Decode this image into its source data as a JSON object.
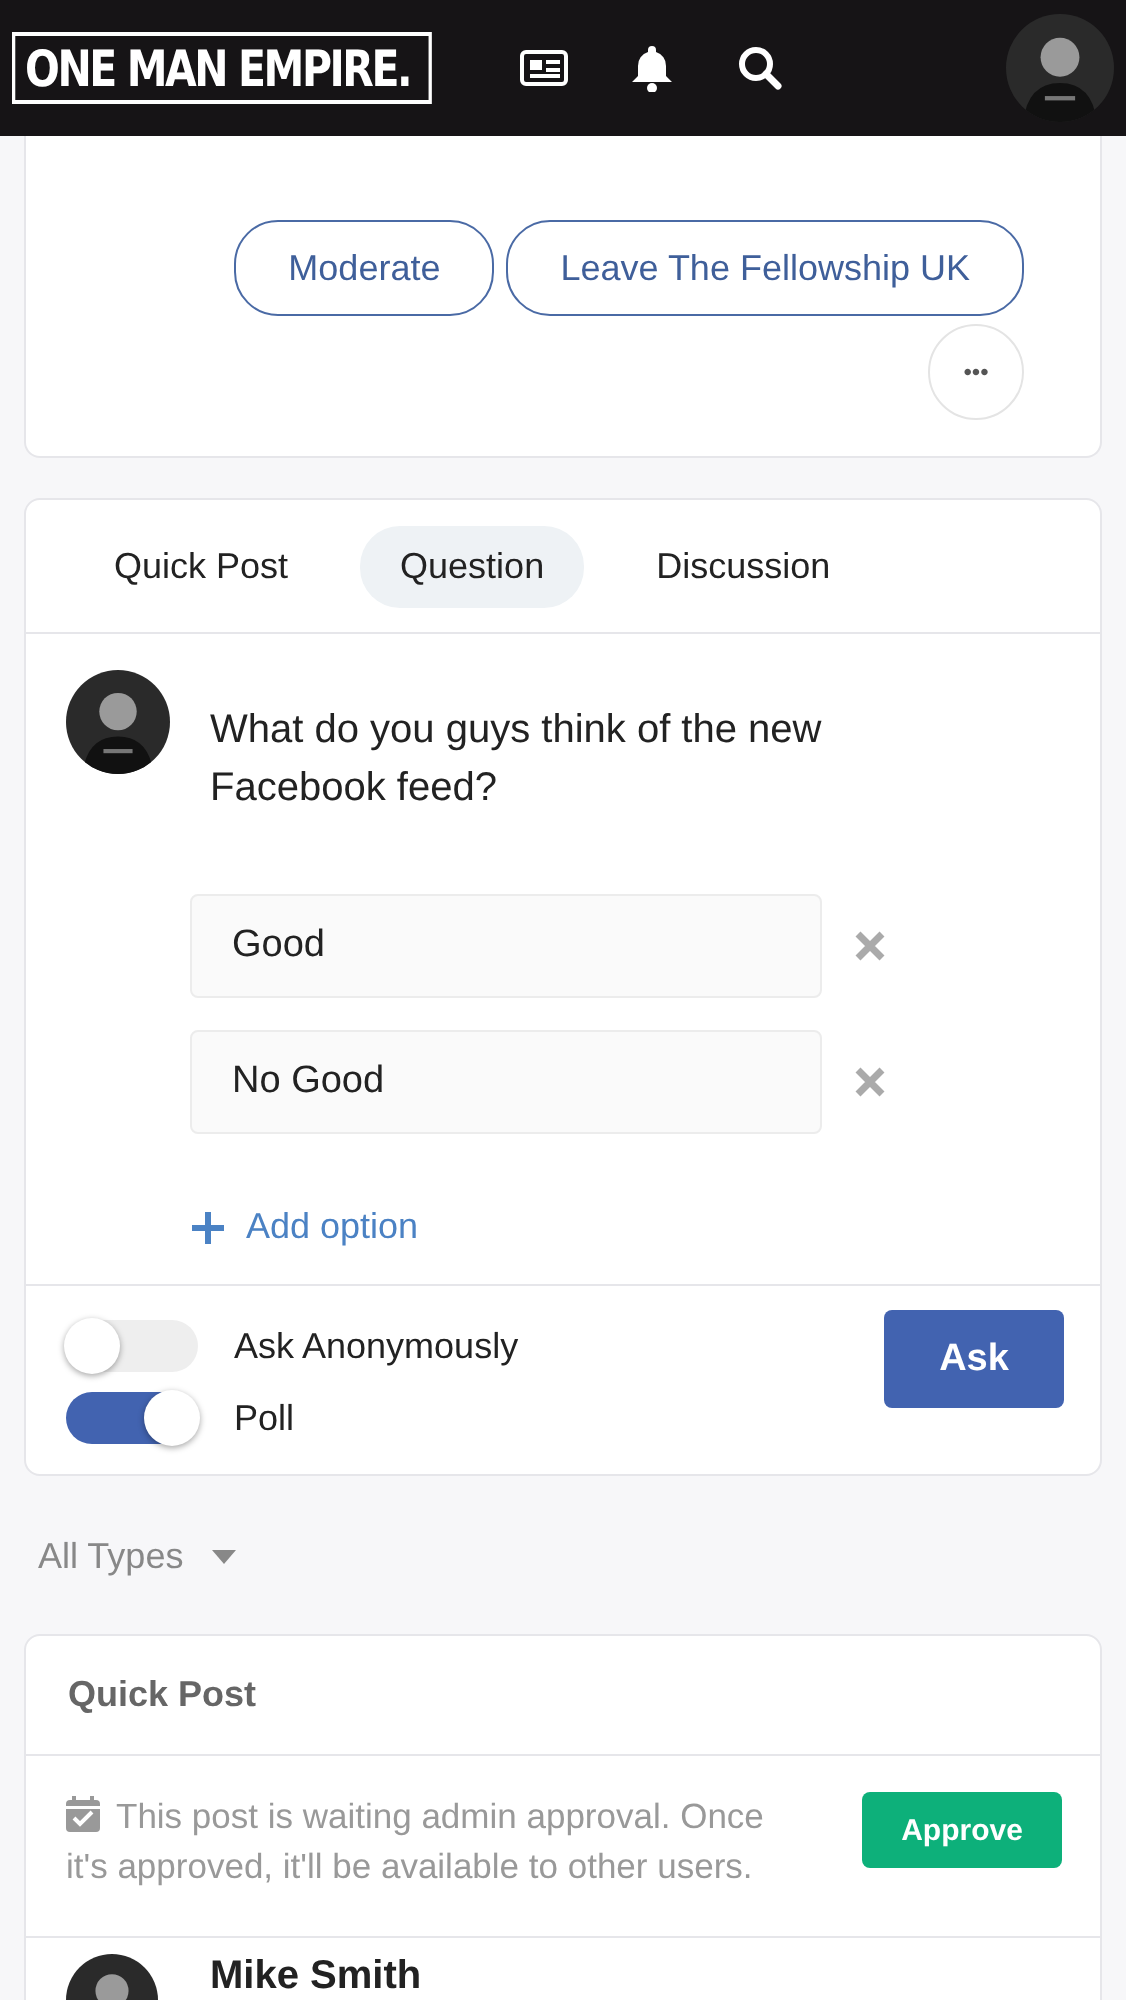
{
  "header": {
    "logo": "ONE MAN EMPIRE."
  },
  "group_actions": [
    {
      "label": "Moderate"
    },
    {
      "label": "Leave The Fellowship UK"
    }
  ],
  "more_button": "•••",
  "composer": {
    "tabs": [
      {
        "label": "Quick Post",
        "selected": false
      },
      {
        "label": "Question",
        "selected": true
      },
      {
        "label": "Discussion",
        "selected": false
      }
    ],
    "question": "What do you guys think of the new Facebook feed?",
    "options": [
      {
        "value": "Good"
      },
      {
        "value": "No Good"
      }
    ],
    "add_option": "Add option",
    "toggles": [
      {
        "label": "Ask Anonymously",
        "on": false
      },
      {
        "label": "Poll",
        "on": true
      }
    ],
    "submit": "Ask"
  },
  "filter": {
    "label": "All Types"
  },
  "post": {
    "title": "Quick Post",
    "notice": "This post is waiting admin approval. Once it's approved, it'll be available to other users.",
    "approve": "Approve",
    "author": "Mike Smith"
  }
}
